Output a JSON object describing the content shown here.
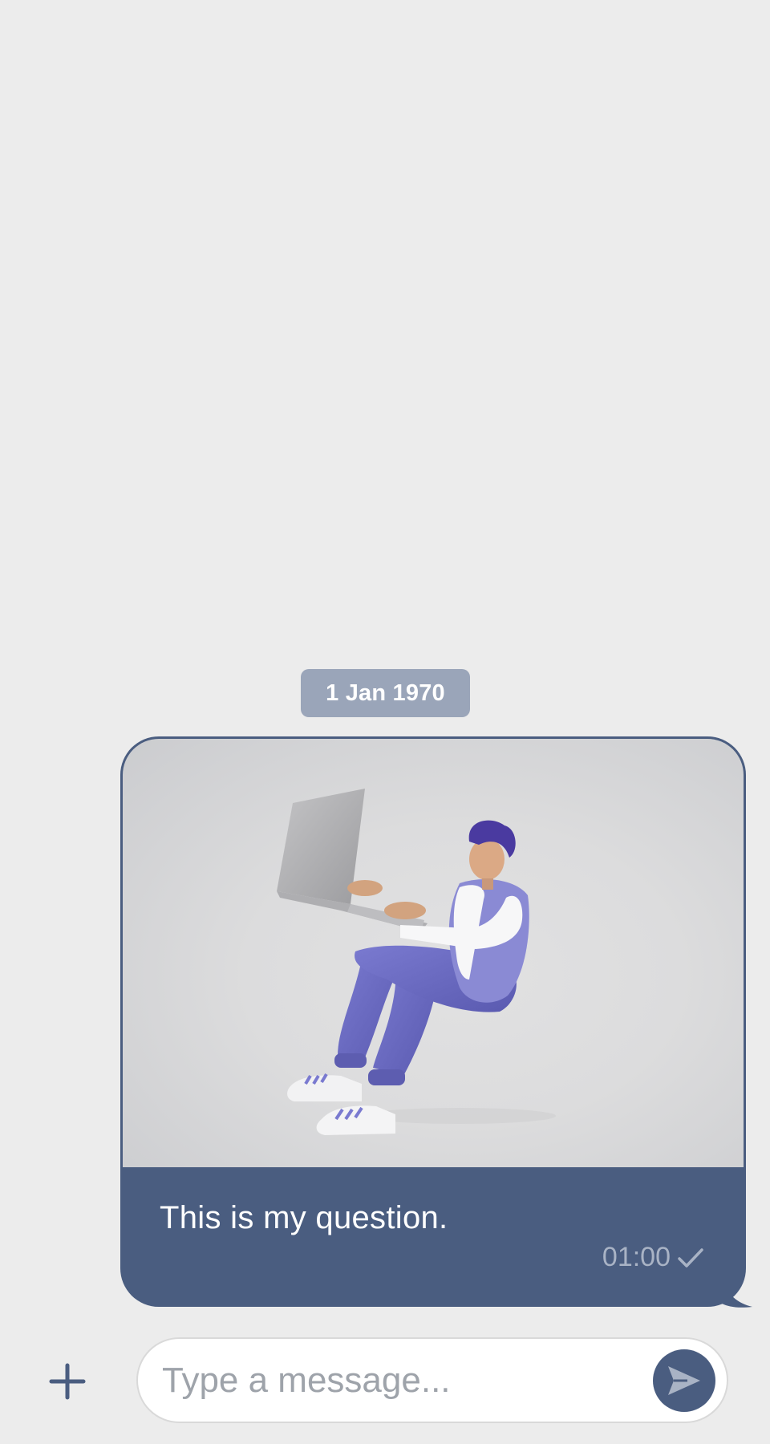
{
  "chat": {
    "date_divider": "1 Jan 1970",
    "message": {
      "text": "This is my question.",
      "time": "01:00",
      "status_icon": "check-icon"
    }
  },
  "composer": {
    "add_icon": "plus-icon",
    "placeholder": "Type a message...",
    "send_icon": "send-icon"
  },
  "colors": {
    "background": "#ececec",
    "bubble": "#4a5d80",
    "date_pill": "#9aa5b9",
    "meta_text": "#a9b3c5"
  }
}
